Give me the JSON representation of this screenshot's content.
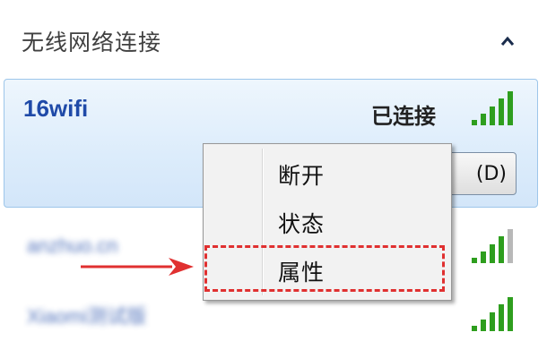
{
  "section": {
    "title": "无线网络连接"
  },
  "connected_network": {
    "ssid": "16wifi",
    "status": "已连接",
    "disconnect_label": "断开(D)",
    "disconnect_visible_text": "(D)",
    "signal_level": "5/5"
  },
  "other_networks": [
    {
      "ssid": "anzhuo.cn"
    },
    {
      "ssid": "Xiaomi测试版"
    }
  ],
  "context_menu": {
    "items": [
      {
        "label": "断开"
      },
      {
        "label": "状态"
      },
      {
        "label": "属性"
      }
    ],
    "highlighted_item": "属性"
  },
  "colors": {
    "ssid_blue": "#1f4aa8",
    "signal_green": "#2e9e1e",
    "highlight_red": "#e03030"
  },
  "icons": [
    "chevron-up-icon",
    "signal-strength-icon",
    "red-arrow-icon"
  ]
}
